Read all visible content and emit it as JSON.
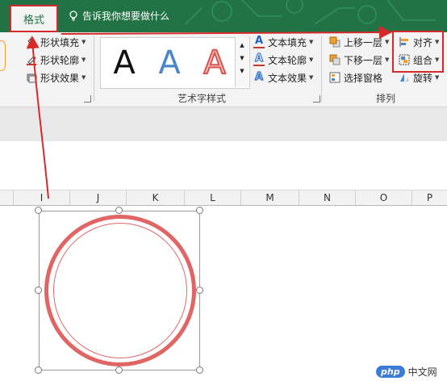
{
  "tabs": {
    "format_label": "格式"
  },
  "tell_me": {
    "placeholder": "告诉我你想要做什么"
  },
  "shape_styles": {
    "fill_label": "形状填充",
    "outline_label": "形状轮廓",
    "effects_label": "形状效果"
  },
  "wordart": {
    "gallery_letters": [
      "A",
      "A",
      "A"
    ],
    "text_fill_label": "文本填充",
    "text_outline_label": "文本轮廓",
    "text_effects_label": "文本效果",
    "group_label": "艺术字样式"
  },
  "arrange": {
    "bring_forward_label": "上移一层",
    "send_backward_label": "下移一层",
    "selection_pane_label": "选择窗格",
    "align_label": "对齐",
    "group_label": "组合",
    "rotate_label": "旋转",
    "group_title": "排列"
  },
  "sheet": {
    "columns": [
      "I",
      "J",
      "K",
      "L",
      "M",
      "N",
      "O",
      "P"
    ]
  },
  "colors": {
    "ribbon_green": "#217346",
    "highlight_red": "#d62a2a",
    "circle_red": "#e06666",
    "text_fill_blue": "#1f5fbf",
    "wordart_blue": "#4a86c8",
    "wordart_red": "#d9534f"
  },
  "watermark": {
    "logo": "php",
    "text": "中文网"
  }
}
